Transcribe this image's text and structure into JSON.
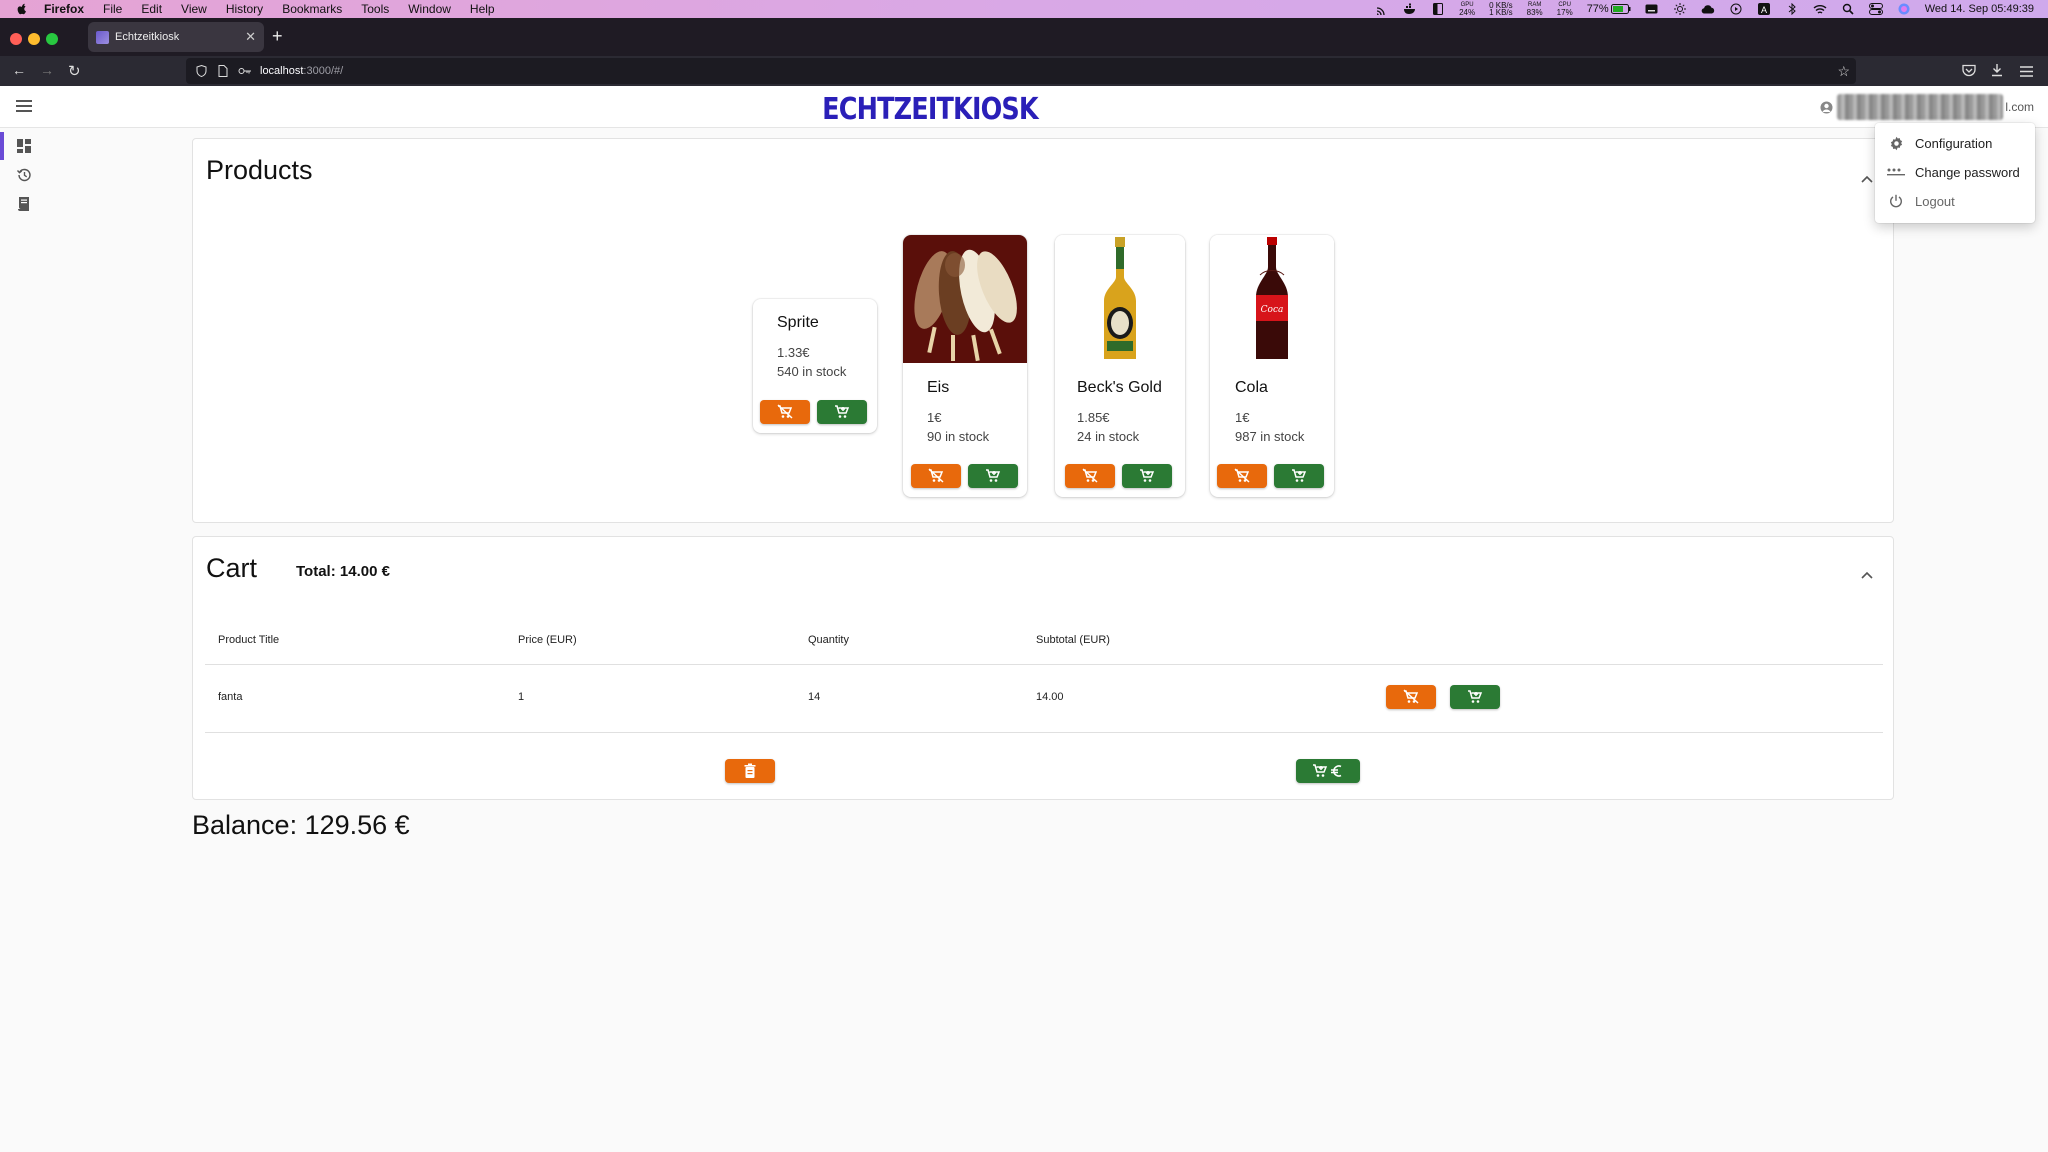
{
  "menubar": {
    "app_name": "Firefox",
    "items": [
      "File",
      "Edit",
      "View",
      "History",
      "Bookmarks",
      "Tools",
      "Window",
      "Help"
    ],
    "status": {
      "gpu": "24%",
      "net_up": "0 KB/s",
      "net_down": "1 KB/s",
      "ram": "83%",
      "cpu": "17%",
      "battery": "77%",
      "datetime": "Wed 14. Sep  05:49:39"
    }
  },
  "browser": {
    "tab_title": "Echtzeitkiosk",
    "url_host": "localhost",
    "url_path": ":3000/#/"
  },
  "app": {
    "logo": "ECHTZEITKIOSK",
    "user_email_suffix": "l.com"
  },
  "user_menu": {
    "items": [
      {
        "label": "Configuration",
        "icon": "gear-icon"
      },
      {
        "label": "Change password",
        "icon": "password-dots-icon"
      },
      {
        "label": "Logout",
        "icon": "power-icon"
      }
    ]
  },
  "products": {
    "title": "Products",
    "items": [
      {
        "name": "Sprite",
        "price": "1.33€",
        "stock": "540 in stock",
        "has_image": false
      },
      {
        "name": "Eis",
        "price": "1€",
        "stock": "90 in stock",
        "has_image": true,
        "image": "ice-cream-bars"
      },
      {
        "name": "Beck's Gold",
        "price": "1.85€",
        "stock": "24 in stock",
        "has_image": true,
        "image": "beer-bottle"
      },
      {
        "name": "Cola",
        "price": "1€",
        "stock": "987 in stock",
        "has_image": true,
        "image": "cola-bottle"
      }
    ]
  },
  "cart": {
    "title": "Cart",
    "total": "Total: 14.00 €",
    "columns": [
      "Product Title",
      "Price (EUR)",
      "Quantity",
      "Subtotal (EUR)"
    ],
    "rows": [
      {
        "title": "fanta",
        "price": "1",
        "quantity": "14",
        "subtotal": "14.00"
      }
    ]
  },
  "balance": "Balance: 129.56 €",
  "colors": {
    "remove": "#e8690c",
    "add": "#2b7a34",
    "logo": "#2a1fb8",
    "accent": "#6a4bd6"
  }
}
